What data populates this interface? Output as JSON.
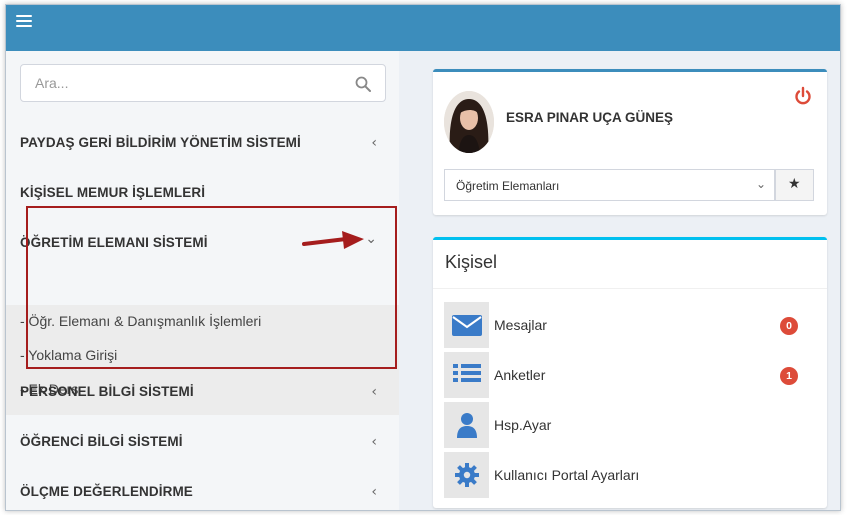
{
  "search": {
    "placeholder": "Ara..."
  },
  "sidebar": {
    "items": [
      {
        "label": "PAYDAŞ GERİ BİLDİRİM YÖNETİM SİSTEMİ",
        "chevron": "‹"
      },
      {
        "label": "KİŞİSEL MEMUR İŞLEMLERİ"
      },
      {
        "label": "ÖĞRETİM ELEMANI SİSTEMİ",
        "chevron": "⌄"
      },
      {
        "label": "PERSONEL BİLGİ SİSTEMİ",
        "chevron": "‹"
      },
      {
        "label": "ÖĞRENCİ BİLGİ SİSTEMİ",
        "chevron": "‹"
      },
      {
        "label": "ÖLÇME DEĞERLENDİRME",
        "chevron": "‹"
      }
    ],
    "subitems": [
      {
        "label": "- Öğr. Elemanı & Danışmanlık İşlemleri"
      },
      {
        "label": "- Yoklama Girişi"
      },
      {
        "label": "- Ek Ders"
      }
    ]
  },
  "profile": {
    "name": "ESRA PINAR UÇA GÜNEŞ",
    "role_select": "Öğretim Elemanları",
    "select_chevron": "⌄",
    "star": "★"
  },
  "kisisel": {
    "title": "Kişisel",
    "rows": [
      {
        "label": "Mesajlar",
        "badge": "0",
        "icon": "envelope-icon"
      },
      {
        "label": "Anketler",
        "badge": "1",
        "icon": "list-icon"
      },
      {
        "label": "Hsp.Ayar",
        "icon": "user-icon"
      },
      {
        "label": "Kullanıcı Portal Ayarları",
        "icon": "gear-icon"
      }
    ]
  },
  "colors": {
    "topbar": "#3c8dbc",
    "accent_blue": "#3a7bc8",
    "badge_red": "#dd4b39",
    "highlight_red": "#a51d1d"
  }
}
